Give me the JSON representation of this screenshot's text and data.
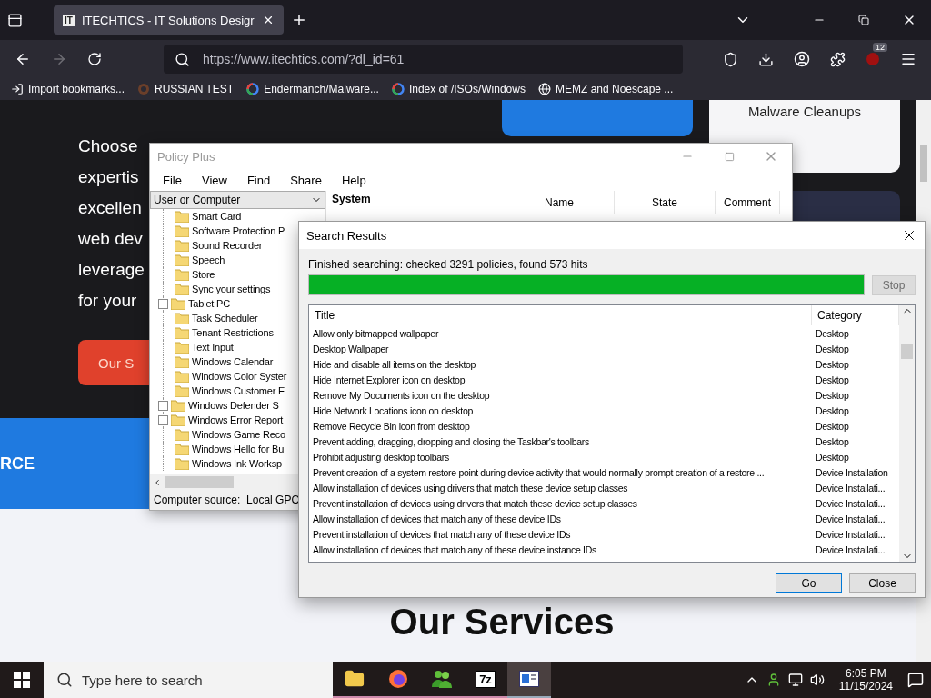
{
  "browser": {
    "tabs": [
      {
        "label": "ITECHTICS - IT Solutions Desigr",
        "favicon": "IT",
        "selected": true
      }
    ],
    "url": "https://www.itechtics.com/?dl_id=61",
    "extension_badge": "12",
    "bookmarks": [
      {
        "kind": "import",
        "label": "Import bookmarks..."
      },
      {
        "kind": "avatar",
        "label": "RUSSIAN TEST"
      },
      {
        "kind": "google",
        "label": "Endermanch/Malware..."
      },
      {
        "kind": "google",
        "label": "Index of /ISOs/Windows"
      },
      {
        "kind": "globe",
        "label": "MEMZ and Noescape ..."
      }
    ]
  },
  "webpage": {
    "hero_lines": [
      "Choose",
      "expertis",
      "excellen",
      "web dev",
      "leverage",
      "for your"
    ],
    "hero_button": "Our S",
    "card_title": "Malware Cleanups",
    "band_text": "RCE",
    "section_heading": "Our Services"
  },
  "policy_plus": {
    "title": "Policy Plus",
    "menu": [
      "File",
      "View",
      "Find",
      "Share",
      "Help"
    ],
    "scope_select": "User or Computer",
    "tree": [
      {
        "label": "Smart Card",
        "kind": "leaf"
      },
      {
        "label": "Software Protection P",
        "kind": "leaf"
      },
      {
        "label": "Sound Recorder",
        "kind": "leaf"
      },
      {
        "label": "Speech",
        "kind": "leaf"
      },
      {
        "label": "Store",
        "kind": "leaf"
      },
      {
        "label": "Sync your settings",
        "kind": "leaf"
      },
      {
        "label": "Tablet PC",
        "kind": "group"
      },
      {
        "label": "Task Scheduler",
        "kind": "leaf"
      },
      {
        "label": "Tenant Restrictions",
        "kind": "leaf"
      },
      {
        "label": "Text Input",
        "kind": "leaf"
      },
      {
        "label": "Windows Calendar",
        "kind": "leaf"
      },
      {
        "label": "Windows Color Syster",
        "kind": "leaf"
      },
      {
        "label": "Windows Customer E",
        "kind": "leaf"
      },
      {
        "label": "Windows Defender S",
        "kind": "group"
      },
      {
        "label": "Windows Error Report",
        "kind": "group"
      },
      {
        "label": "Windows Game Reco",
        "kind": "leaf"
      },
      {
        "label": "Windows Hello for Bu",
        "kind": "leaf"
      },
      {
        "label": "Windows Ink Worksp",
        "kind": "leaf"
      }
    ],
    "status": "Computer source:  Local GPO",
    "section": "System",
    "columns": [
      "Name",
      "State",
      "Comment"
    ]
  },
  "search_results": {
    "title": "Search Results",
    "status": "Finished searching: checked 3291 policies, found 573 hits",
    "progress": {
      "level": 1
    },
    "stop_button": {
      "label": "Stop",
      "disabled": true
    },
    "columns": [
      "Title",
      "Category"
    ],
    "rows": [
      {
        "title": "Allow only bitmapped wallpaper",
        "category": "Desktop"
      },
      {
        "title": "Desktop Wallpaper",
        "category": "Desktop"
      },
      {
        "title": "Hide and disable all items on the desktop",
        "category": "Desktop"
      },
      {
        "title": "Hide Internet Explorer icon on desktop",
        "category": "Desktop"
      },
      {
        "title": "Remove My Documents icon on the desktop",
        "category": "Desktop"
      },
      {
        "title": "Hide Network Locations icon on desktop",
        "category": "Desktop"
      },
      {
        "title": "Remove Recycle Bin icon from desktop",
        "category": "Desktop"
      },
      {
        "title": "Prevent adding, dragging, dropping and closing the Taskbar's toolbars",
        "category": "Desktop"
      },
      {
        "title": "Prohibit adjusting desktop toolbars",
        "category": "Desktop"
      },
      {
        "title": "Prevent creation of a system restore point during device activity that would normally prompt creation of a restore ...",
        "category": "Device Installation"
      },
      {
        "title": "Allow installation of devices using drivers that match these device setup classes",
        "category": "Device Installati..."
      },
      {
        "title": "Prevent installation of devices using drivers that match these device setup classes",
        "category": "Device Installati..."
      },
      {
        "title": "Allow installation of devices that match any of these device IDs",
        "category": "Device Installati..."
      },
      {
        "title": "Prevent installation of devices that match any of these device IDs",
        "category": "Device Installati..."
      },
      {
        "title": "Allow installation of devices that match any of these device instance IDs",
        "category": "Device Installati..."
      }
    ],
    "buttons": [
      {
        "label": "Go",
        "kind": "default"
      },
      {
        "label": "Close",
        "kind": "normal"
      }
    ]
  },
  "taskbar": {
    "search_placeholder": "Type here to search",
    "apps": [
      {
        "kind": "explorer",
        "selected": false
      },
      {
        "kind": "firefox",
        "selected": false
      },
      {
        "kind": "people",
        "selected": false
      },
      {
        "kind": "archiver",
        "label": "7z",
        "selected": false
      },
      {
        "kind": "policy",
        "selected": true
      }
    ],
    "time": "6:05 PM",
    "date": "11/15/2024"
  }
}
